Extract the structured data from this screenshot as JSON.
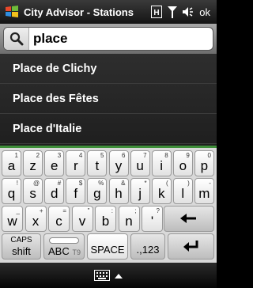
{
  "titlebar": {
    "title": "City Advisor - Stations",
    "ok_label": "ok"
  },
  "search": {
    "value": "place"
  },
  "results": [
    "Place de Clichy",
    "Place des Fêtes",
    "Place d'Italie"
  ],
  "keyboard": {
    "row1": [
      {
        "top": "1",
        "main": "a"
      },
      {
        "top": "2",
        "main": "z"
      },
      {
        "top": "3",
        "main": "e"
      },
      {
        "top": "4",
        "main": "r"
      },
      {
        "top": "5",
        "main": "t"
      },
      {
        "top": "6",
        "main": "y"
      },
      {
        "top": "7",
        "main": "u"
      },
      {
        "top": "8",
        "main": "i"
      },
      {
        "top": "9",
        "main": "o"
      },
      {
        "top": "0",
        "main": "p"
      }
    ],
    "row2": [
      {
        "top": "!",
        "main": "q"
      },
      {
        "top": "@",
        "main": "s"
      },
      {
        "top": "#",
        "main": "d"
      },
      {
        "top": "$",
        "main": "f"
      },
      {
        "top": "%",
        "main": "g"
      },
      {
        "top": "&",
        "main": "h"
      },
      {
        "top": "*",
        "main": "j"
      },
      {
        "top": "(",
        "main": "k"
      },
      {
        "top": ")",
        "main": "l"
      },
      {
        "top": "-",
        "main": "m"
      }
    ],
    "row3": [
      {
        "top": "_",
        "main": "w"
      },
      {
        "top": "+",
        "main": "x"
      },
      {
        "top": "=",
        "main": "c"
      },
      {
        "top": "\"",
        "main": "v"
      },
      {
        "top": ":",
        "main": "b"
      },
      {
        "top": ";",
        "main": "n"
      },
      {
        "top": "?",
        "main": "'"
      }
    ],
    "caps_label": "CAPS",
    "shift_label": "shift",
    "abc_label": "ABC",
    "t9_label": "T9",
    "space_label": "SPACE",
    "symbols_label": ".,123"
  },
  "colors": {
    "accent_green": "#3f8f3a"
  }
}
